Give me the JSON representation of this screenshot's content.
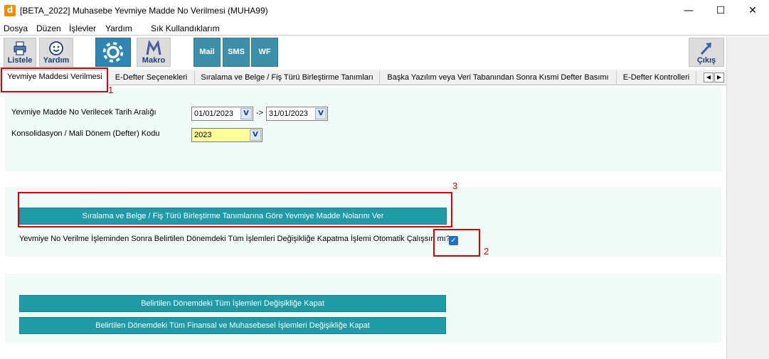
{
  "window": {
    "app_icon_letter": "d",
    "title": "[BETA_2022] Muhasebe Yevmiye Madde No Verilmesi (MUHA99)",
    "minimize": "—",
    "maximize": "☐",
    "close": "✕"
  },
  "menu": [
    "Dosya",
    "Düzen",
    "İşlevler",
    "Yardım",
    "Sık Kullandıklarım"
  ],
  "toolbar": {
    "listele": "Listele",
    "yardim": "Yardım",
    "makro": "Makro",
    "mail": "Mail",
    "sms": "SMS",
    "wf": "WF",
    "cikis": "Çıkış"
  },
  "tabs": [
    "Yevmiye Maddesi Verilmesi",
    "E-Defter Seçenekleri",
    "Sıralama ve Belge / Fiş Türü Birleştirme Tanımları",
    "Başka Yazılım veya Veri Tabanından Sonra Kısmi Defter Basımı",
    "E-Defter Kontrolleri"
  ],
  "tab_nav": {
    "left": "◀",
    "right": "▶"
  },
  "form": {
    "date_range_label": "Yevmiye Madde No Verilecek Tarih Aralığı",
    "date_from": "01/01/2023",
    "date_sep": "->",
    "date_to": "31/01/2023",
    "period_label": "Konsolidasyon / Mali Dönem (Defter) Kodu",
    "period_value": "2023",
    "dropdown_glyph": "V"
  },
  "actions": {
    "assign_button": "Sıralama ve Belge / Fiş Türü Birleştirme Tanımlarına Göre Yevmiye Madde Nolarını Ver",
    "auto_close_question": "Yevmiye No Verilme İşleminden Sonra Belirtilen Dönemdeki Tüm İşlemleri Değişikliğe Kapatma İşlemi Otomatik Çalışsın mı?",
    "auto_close_checked": true,
    "check_glyph": "✓",
    "close_all_button": "Belirtilen Dönemdeki Tüm İşlemleri Değişikliğe Kapat",
    "close_financial_button": "Belirtilen Dönemdeki Tüm Finansal ve Muhasebesel İşlemleri Değişikliğe Kapat"
  },
  "annotations": [
    "1",
    "2",
    "3"
  ],
  "colors": {
    "panel_bg": "#f0fbf8",
    "action_teal": "#1f9aa7",
    "highlight_red": "#e00000",
    "period_yellow": "#ffff9a"
  }
}
